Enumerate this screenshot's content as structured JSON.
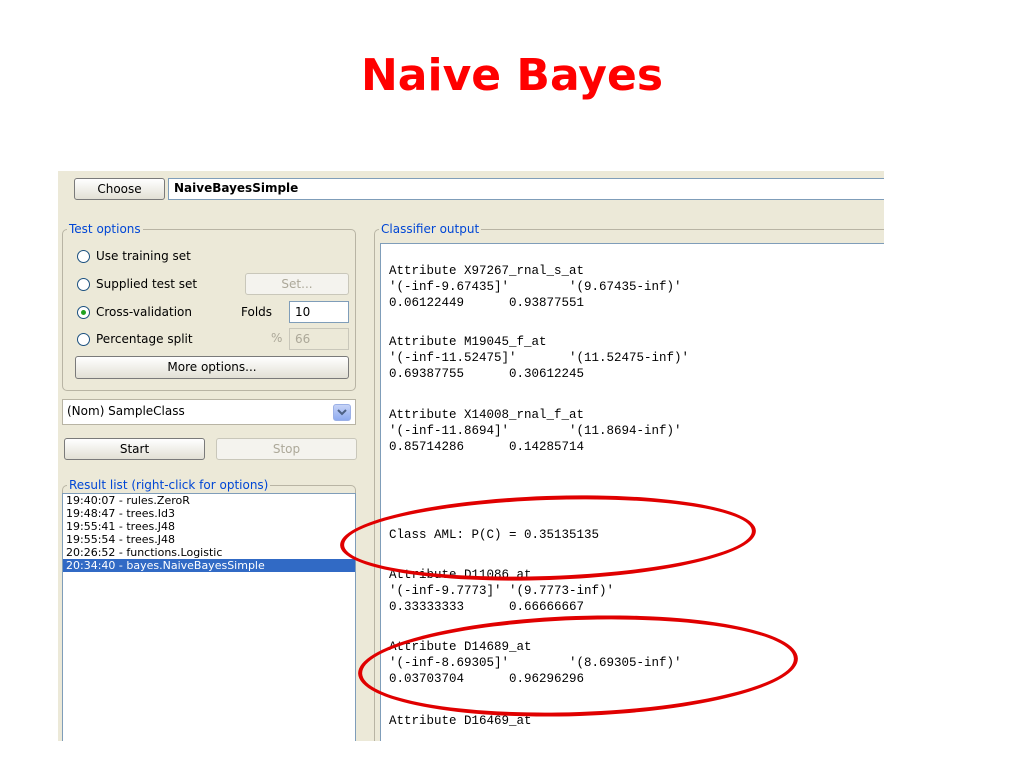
{
  "slide": {
    "title": "Naive Bayes",
    "annotation_color": "#e00000"
  },
  "classifier": {
    "choose_label": "Choose",
    "name": "NaiveBayesSimple"
  },
  "test_options": {
    "title": "Test options",
    "use_training_set": "Use training set",
    "supplied_test_set": "Supplied test set",
    "set_button": "Set...",
    "cross_validation": "Cross-validation",
    "folds_label": "Folds",
    "folds_value": "10",
    "percentage_split": "Percentage split",
    "percent_symbol": "%",
    "percent_value": "66",
    "more_options": "More options...",
    "selected": "cross_validation"
  },
  "class_attribute": "(Nom) SampleClass",
  "controls": {
    "start": "Start",
    "stop": "Stop"
  },
  "result_list": {
    "title": "Result list (right-click for options)",
    "items": [
      "19:40:07 - rules.ZeroR",
      "19:48:47 - trees.Id3",
      "19:55:41 - trees.J48",
      "19:55:54 - trees.J48",
      "20:26:52 - functions.Logistic",
      "20:34:40 - bayes.NaiveBayesSimple"
    ],
    "selected_index": 5
  },
  "output": {
    "title": "Classifier output",
    "lines": [
      "Attribute X97267_rnal_s_at",
      "'(-inf-9.67435]'        '(9.67435-inf)'",
      "0.06122449      0.93877551",
      "Attribute M19045_f_at",
      "'(-inf-11.52475]'       '(11.52475-inf)'",
      "0.69387755      0.30612245",
      "Attribute X14008_rnal_f_at",
      "'(-inf-11.8694]'        '(11.8694-inf)'",
      "0.85714286      0.14285714",
      "Class AML: P(C) = 0.35135135",
      "Attribute D11086_at",
      "'(-inf-9.7773]' '(9.7773-inf)'",
      "0.33333333      0.66666667",
      "Attribute D14689_at",
      "'(-inf-8.69305]'        '(8.69305-inf)'",
      "0.03703704      0.96296296",
      "Attribute D16469_at"
    ]
  }
}
